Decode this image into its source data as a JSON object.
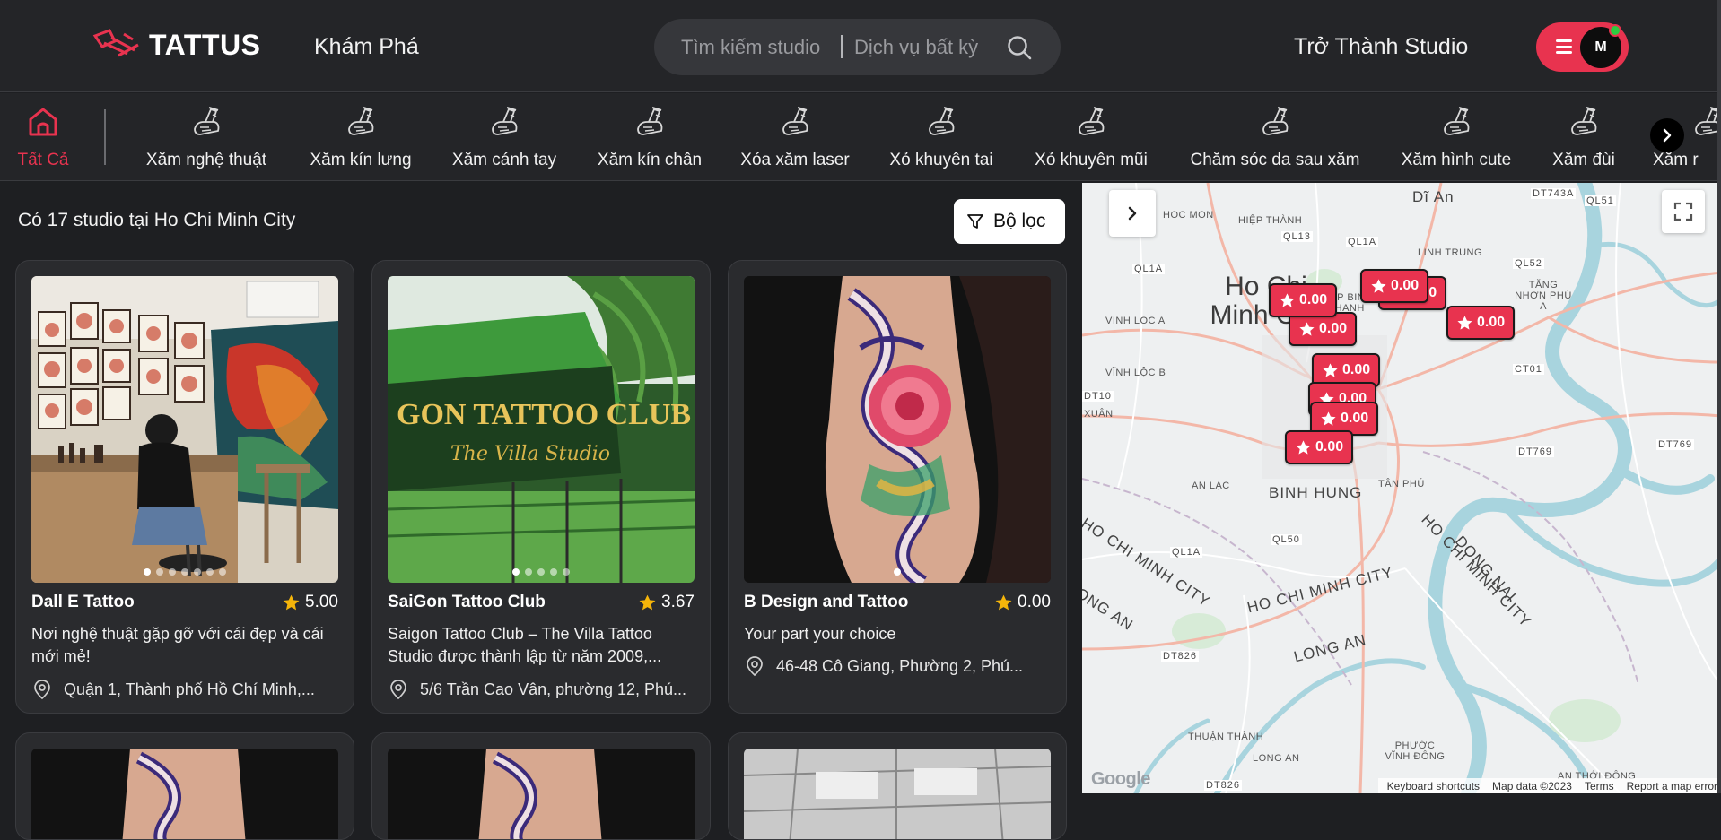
{
  "header": {
    "logo_text": "TATTUS",
    "explore_label": "Khám Phá",
    "search_studio_placeholder": "Tìm kiếm studio",
    "search_service_placeholder": "Dịch vụ bất kỳ",
    "become_studio_label": "Trở Thành Studio",
    "avatar_initial": "M",
    "accent_color": "#e8334f"
  },
  "categories": {
    "active": "Tất Cả",
    "items": [
      {
        "label": "Tất Cả",
        "icon": "home-icon"
      },
      {
        "label": "Xăm nghệ thuật",
        "icon": "tattoo-machine-icon"
      },
      {
        "label": "Xăm kín lưng",
        "icon": "tattoo-machine-icon"
      },
      {
        "label": "Xăm cánh tay",
        "icon": "tattoo-machine-icon"
      },
      {
        "label": "Xăm kín chân",
        "icon": "tattoo-machine-icon"
      },
      {
        "label": "Xóa xăm laser",
        "icon": "tattoo-machine-icon"
      },
      {
        "label": "Xỏ khuyên tai",
        "icon": "tattoo-machine-icon"
      },
      {
        "label": "Xỏ khuyên mũi",
        "icon": "tattoo-machine-icon"
      },
      {
        "label": "Chăm sóc da sau xăm",
        "icon": "tattoo-machine-icon"
      },
      {
        "label": "Xăm hình cute",
        "icon": "tattoo-machine-icon"
      },
      {
        "label": "Xăm đùi",
        "icon": "tattoo-machine-icon"
      },
      {
        "label": "Xăm r",
        "icon": "tattoo-machine-icon"
      }
    ]
  },
  "listing": {
    "count_text": "Có 17 studio tại Ho Chi Minh City",
    "filter_label": "Bộ lọc",
    "studios": [
      {
        "name": "Dall E Tattoo",
        "rating": "5.00",
        "description": "Nơi nghệ thuật gặp gỡ với cái đẹp và cái mới mẻ!",
        "address": "Quận 1, Thành phố Hồ Chí Minh,...",
        "dots": 7,
        "active_dot": 0
      },
      {
        "name": "SaiGon Tattoo Club",
        "rating": "3.67",
        "description": "Saigon Tattoo Club – The Villa Tattoo Studio được thành lập từ năm 2009,...",
        "address": "5/6 Trần Cao Vân, phường 12, Phú...",
        "dots": 5,
        "active_dot": 0
      },
      {
        "name": "B Design and Tattoo",
        "rating": "0.00",
        "description": "Your part your choice",
        "address": "46-48 Cô Giang, Phường 2, Phú...",
        "dots": 1,
        "active_dot": 0
      }
    ]
  },
  "map": {
    "city_label": "Ho Chi Minh City",
    "district_labels": [
      "Dĩ An",
      "BINH HUNG",
      "HOC MON",
      "HIỆP THÀNH",
      "LINH TRUNG",
      "TĂNG NHƠN PHÚ A",
      "HIEP BINH CHANH",
      "VINH LOC A",
      "VĨNH LỘC B",
      "XUÂN",
      "AN LẠC",
      "TÂN PHÚ",
      "THUẬN THÀNH",
      "LONG AN",
      "PHƯỚC VĨNH ĐÔNG",
      "AN THỚI ĐÔNG",
      "DONG NAI"
    ],
    "region_labels": [
      "HO CHI MINH CITY",
      "HO CHI MINH CITY",
      "HO CHI MINH CITY",
      "LONG AN",
      "ONG AN"
    ],
    "road_labels": [
      "DT743A",
      "QL13",
      "QL1A",
      "QL1A",
      "QL52",
      "QL51",
      "DT10",
      "CT01",
      "DT769",
      "DT769",
      "QL50",
      "QL1A",
      "DT826",
      "DT826"
    ],
    "markers": [
      "0.00",
      "0.00",
      "0.00",
      "0.00",
      "0.00",
      "0.00",
      "0.00",
      "0.00",
      "0.00"
    ],
    "google_text": "Google",
    "attribution": [
      "Keyboard shortcuts",
      "Map data ©2023",
      "Terms",
      "Report a map error"
    ]
  }
}
